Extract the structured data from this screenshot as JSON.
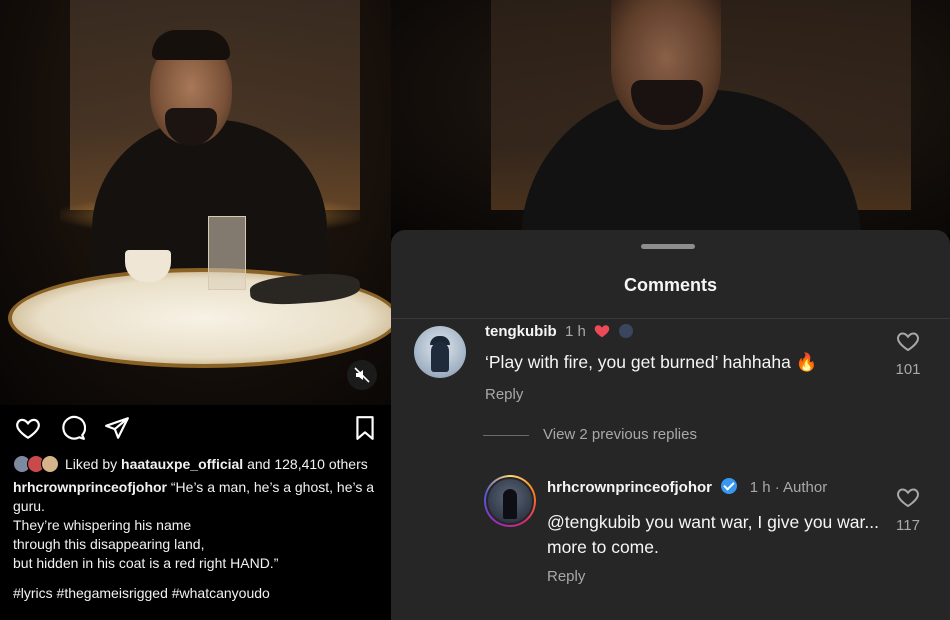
{
  "post": {
    "liked_by_prefix": "Liked by",
    "liked_by_user": "haatauxpe_official",
    "liked_by_suffix": "and 128,410 others",
    "caption_user": "hrhcrownprinceofjohor",
    "caption_lines": [
      "“He’s a man, he’s a ghost, he’s a guru.",
      "They’re whispering his name",
      "through this disappearing land,",
      "but hidden in his coat is a red right HAND.”"
    ],
    "hashtags": "#lyrics #thegameisrigged #whatcanyoudo",
    "icons": {
      "like": "heart-outline-icon",
      "comment": "comment-bubble-icon",
      "share": "paper-plane-icon",
      "save": "bookmark-icon",
      "mute": "speaker-muted-icon"
    }
  },
  "comments_sheet": {
    "title": "Comments",
    "comments": [
      {
        "username": "tengkubib",
        "time": "1 h",
        "text": "‘Play with fire, you get burned’ hahhaha 🔥",
        "reply_label": "Reply",
        "likes": "101"
      },
      {
        "username": "hrhcrownprinceofjohor",
        "time": "1 h · Author",
        "text": "@tengkubib you want war, I give you war... more to come.",
        "reply_label": "Reply",
        "likes": "117"
      }
    ],
    "view_replies_label": "View 2 previous replies"
  },
  "colors": {
    "sheet_bg": "#262626",
    "heart_red": "#ed4956",
    "verified_blue": "#3897f0",
    "muted_text": "#a8a8a8"
  }
}
